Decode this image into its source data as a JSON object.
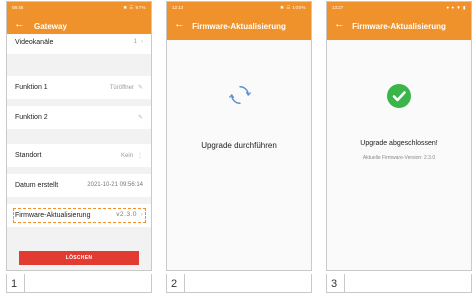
{
  "colors": {
    "accent": "#f0922b",
    "delete": "#e23b32",
    "success": "#39b54a"
  },
  "screen1": {
    "status_time": "08:45",
    "status_icons": "✱ ☰ 97%",
    "title": "Gateway",
    "rows": [
      {
        "label": "Videokanäle",
        "value": "1",
        "icon": "›",
        "icon_name": "chevron-right-icon"
      },
      {
        "label": "Funktion 1",
        "value": "Türöffner",
        "icon": "✎",
        "icon_name": "edit-icon"
      },
      {
        "label": "Funktion 2",
        "value": "",
        "icon": "✎",
        "icon_name": "edit-icon"
      },
      {
        "label": "Standort",
        "value": "Kein",
        "icon": "⋮",
        "icon_name": "more-icon"
      },
      {
        "label": "Datum erstellt",
        "value": "2021-10-21 09:56:14",
        "icon": "",
        "icon_name": ""
      },
      {
        "label": "Firmware-Aktualisierung",
        "value": "v2.3.0",
        "icon": "›",
        "icon_name": "chevron-right-icon"
      }
    ],
    "delete_label": "LÖSCHEN",
    "caption": "1"
  },
  "screen2": {
    "status_time": "12:13",
    "status_icons": "✱ ☰ 100%",
    "title": "Firmware-Aktualisierung",
    "message": "Upgrade durchführen",
    "caption": "2"
  },
  "screen3": {
    "status_time": "13:27",
    "status_icons": "● ● ▼ ▮",
    "title": "Firmware-Aktualisierung",
    "message": "Upgrade abgeschlossen!",
    "sub_message": "Aktuelle Firmware-Version: 2.3.0",
    "caption": "3"
  }
}
